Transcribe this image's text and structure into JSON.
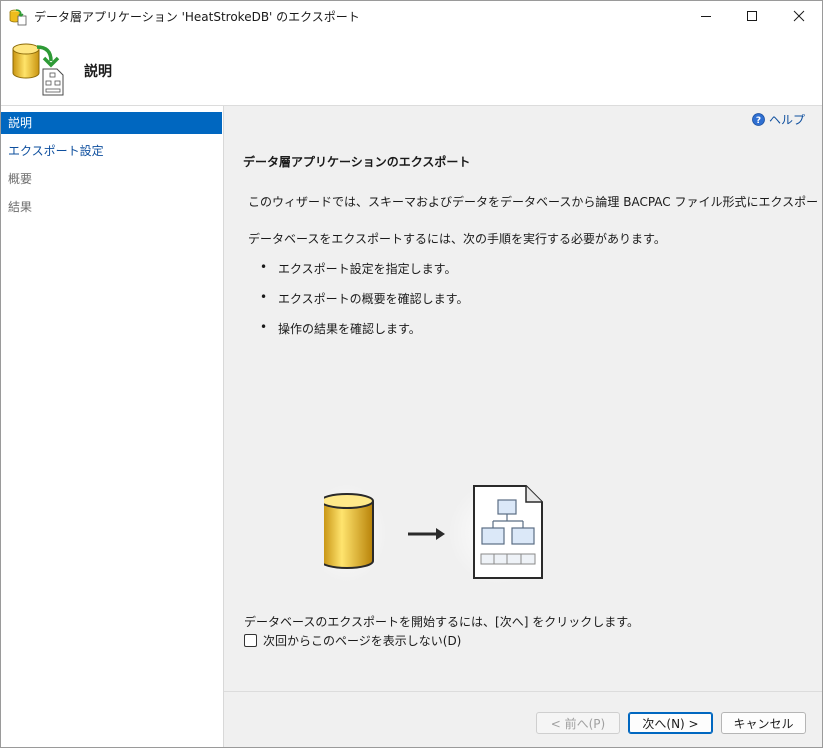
{
  "window": {
    "title": "データ層アプリケーション 'HeatStrokeDB' のエクスポート",
    "buttons": {
      "minimize": "minimize-icon",
      "maximize": "maximize-icon",
      "close": "close-icon"
    }
  },
  "header": {
    "title": "説明"
  },
  "sidebar": {
    "items": [
      {
        "label": "説明",
        "state": "active"
      },
      {
        "label": "エクスポート設定",
        "state": "link"
      },
      {
        "label": "概要",
        "state": "disabled"
      },
      {
        "label": "結果",
        "state": "disabled"
      }
    ]
  },
  "content": {
    "help_label": "ヘルプ",
    "title": "データ層アプリケーションのエクスポート",
    "intro": "このウィザードでは、スキーマおよびデータをデータベースから論理 BACPAC ファイル形式にエクスポートできます。",
    "steps_heading": "データベースをエクスポートするには、次の手順を実行する必要があります。",
    "steps": [
      "エクスポート設定を指定します。",
      "エクスポートの概要を確認します。",
      "操作の結果を確認します。"
    ],
    "start_instruction": "データベースのエクスポートを開始するには、[次へ] をクリックします。",
    "skip_checkbox_label": "次回からこのページを表示しない(D)",
    "skip_checkbox_checked": false
  },
  "footer": {
    "back_label": "< 前へ(P)",
    "next_label": "次へ(N) >",
    "cancel_label": "キャンセル"
  },
  "colors": {
    "accent": "#0067c0",
    "link": "#0e4f9e",
    "db_gold": "#f2c420"
  }
}
